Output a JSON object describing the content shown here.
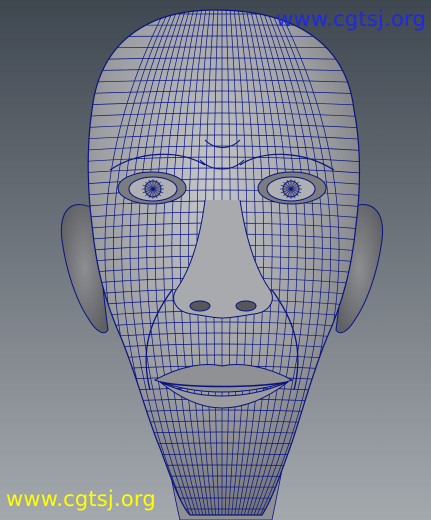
{
  "viewport": {
    "background_top": "#3f4750",
    "background_bottom": "#a4a9ae",
    "mesh_surface": "#9c9ea2",
    "wireframe_color": "#0a1480",
    "object": "head-mesh"
  },
  "watermarks": {
    "top_right": {
      "text": "www.cgtsj.org",
      "color": "#1e28e6"
    },
    "bottom_left": {
      "text": "www.cgtsj.org",
      "color": "#ffff00"
    }
  }
}
